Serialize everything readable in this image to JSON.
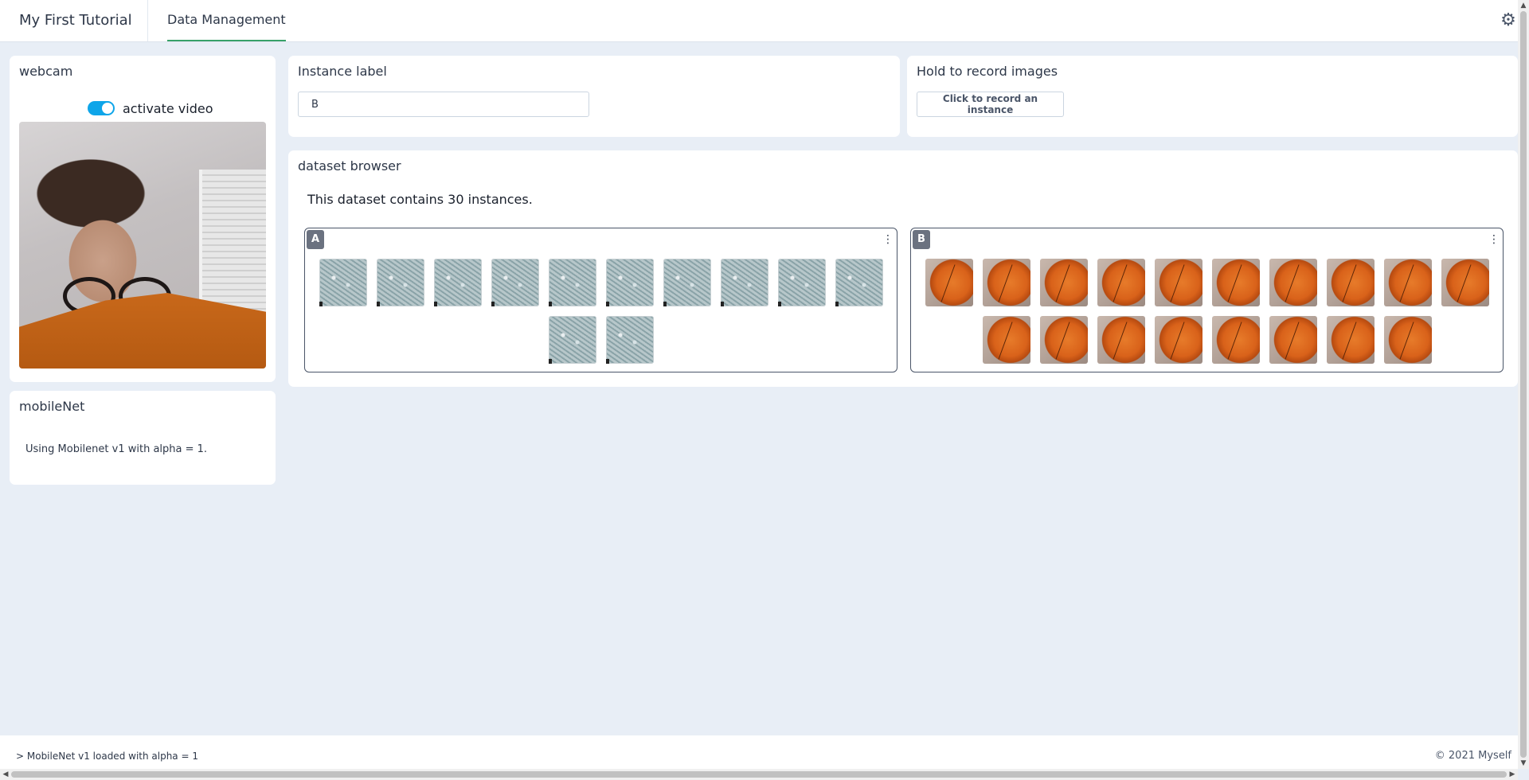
{
  "header": {
    "app_title": "My First Tutorial",
    "tabs": [
      {
        "label": "Data Management",
        "active": true
      }
    ],
    "settings_icon": "gear-icon"
  },
  "webcam": {
    "title": "webcam",
    "toggle_label": "activate video",
    "toggle_on": true
  },
  "mobilenet": {
    "title": "mobileNet",
    "description": "Using Mobilenet v1 with alpha = 1."
  },
  "instance_label": {
    "title": "Instance label",
    "value": "B"
  },
  "record": {
    "title": "Hold to record images",
    "button_label": "Click to record an instance"
  },
  "dataset": {
    "title": "dataset browser",
    "count_text": "This dataset contains 30 instances.",
    "classes": [
      {
        "label": "A",
        "instance_count": 12
      },
      {
        "label": "B",
        "instance_count": 18
      }
    ]
  },
  "footer": {
    "log": ">  MobileNet v1 loaded with alpha = 1",
    "copyright": "© 2021 Myself"
  },
  "colors": {
    "accent_toggle": "#0ea5e9",
    "tab_underline": "#38a169",
    "page_bg": "#e8eef6"
  }
}
